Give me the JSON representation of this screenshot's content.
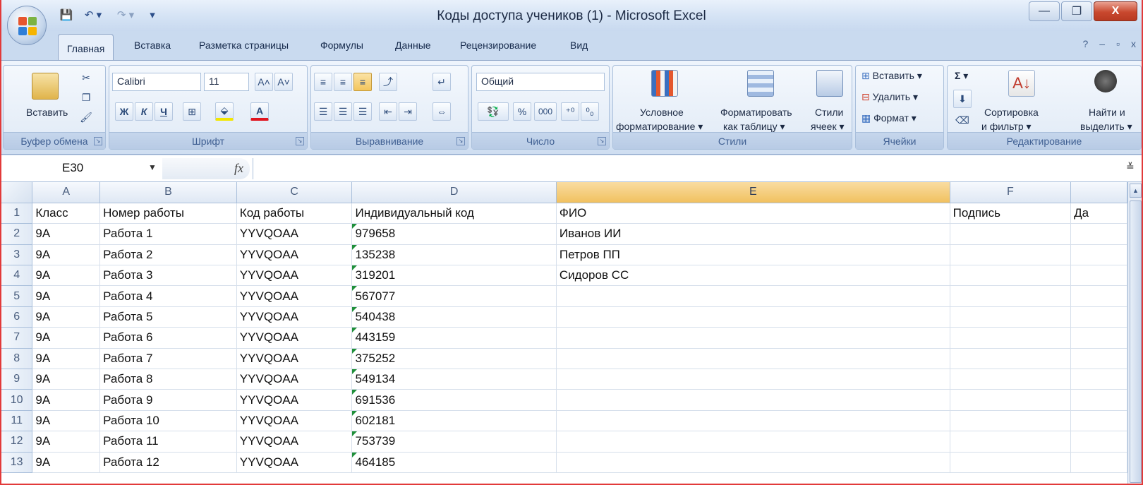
{
  "window": {
    "title": "Коды доступа учеников (1) - Microsoft Excel",
    "minimize": "—",
    "restore": "❐",
    "close": "X"
  },
  "qat": {
    "save": "💾",
    "undo": "↶ ▾",
    "redo": "↷ ▾",
    "customize": "▾"
  },
  "tabs": [
    "Главная",
    "Вставка",
    "Разметка страницы",
    "Формулы",
    "Данные",
    "Рецензирование",
    "Вид"
  ],
  "help": {
    "help": "?",
    "min": "–",
    "restore": "▫",
    "close": "x"
  },
  "ribbon": {
    "clipboard": {
      "label": "Буфер обмена",
      "paste": "Вставить"
    },
    "font": {
      "label": "Шрифт",
      "name": "Calibri",
      "size": "11",
      "bold": "Ж",
      "italic": "К",
      "underline": "Ч",
      "grow": "A˄",
      "shrink": "A˅"
    },
    "alignment": {
      "label": "Выравнивание"
    },
    "number": {
      "label": "Число",
      "format": "Общий",
      "percent": "%",
      "thousands": "000",
      "inc_decimal": "⁺⁰",
      "dec_decimal": "⁰₀"
    },
    "styles": {
      "label": "Стили",
      "conditional_1": "Условное",
      "conditional_2": "форматирование ▾",
      "table_1": "Форматировать",
      "table_2": "как таблицу ▾",
      "cell_1": "Стили",
      "cell_2": "ячеек ▾"
    },
    "cells": {
      "label": "Ячейки",
      "insert": "Вставить ▾",
      "delete": "Удалить ▾",
      "format": "Формат ▾"
    },
    "editing": {
      "label": "Редактирование",
      "sum": "Σ ▾",
      "sort_1": "Сортировка",
      "sort_2": "и фильтр ▾",
      "find_1": "Найти и",
      "find_2": "выделить ▾"
    }
  },
  "formula_bar": {
    "cell": "E30",
    "fx": "fx",
    "value": "",
    "expand": "≚"
  },
  "sheet": {
    "columns": [
      "A",
      "B",
      "C",
      "D",
      "E",
      "F",
      ""
    ],
    "selected_column": "E",
    "rows": [
      {
        "n": "1",
        "cells": [
          "Класс",
          "Номер работы",
          "Код работы",
          "Индивидуальный код",
          "ФИО",
          "Подпись",
          "Да"
        ]
      },
      {
        "n": "2",
        "cells": [
          "9А",
          "Работа 1",
          "YYVQOAA",
          "979658",
          "Иванов ИИ",
          "",
          ""
        ]
      },
      {
        "n": "3",
        "cells": [
          "9А",
          "Работа 2",
          "YYVQOAA",
          "135238",
          "Петров ПП",
          "",
          ""
        ]
      },
      {
        "n": "4",
        "cells": [
          "9А",
          "Работа 3",
          "YYVQOAA",
          "319201",
          "Сидоров СС",
          "",
          ""
        ]
      },
      {
        "n": "5",
        "cells": [
          "9А",
          "Работа 4",
          "YYVQOAA",
          "567077",
          "",
          "",
          ""
        ]
      },
      {
        "n": "6",
        "cells": [
          "9А",
          "Работа 5",
          "YYVQOAA",
          "540438",
          "",
          "",
          ""
        ]
      },
      {
        "n": "7",
        "cells": [
          "9А",
          "Работа 6",
          "YYVQOAA",
          "443159",
          "",
          "",
          ""
        ]
      },
      {
        "n": "8",
        "cells": [
          "9А",
          "Работа 7",
          "YYVQOAA",
          "375252",
          "",
          "",
          ""
        ]
      },
      {
        "n": "9",
        "cells": [
          "9А",
          "Работа 8",
          "YYVQOAA",
          "549134",
          "",
          "",
          ""
        ]
      },
      {
        "n": "10",
        "cells": [
          "9А",
          "Работа 9",
          "YYVQOAA",
          "691536",
          "",
          "",
          ""
        ]
      },
      {
        "n": "11",
        "cells": [
          "9А",
          "Работа 10",
          "YYVQOAA",
          "602181",
          "",
          "",
          ""
        ]
      },
      {
        "n": "12",
        "cells": [
          "9А",
          "Работа 11",
          "YYVQOAA",
          "753739",
          "",
          "",
          ""
        ]
      },
      {
        "n": "13",
        "cells": [
          "9А",
          "Работа 12",
          "YYVQOAA",
          "464185",
          "",
          "",
          ""
        ]
      }
    ]
  },
  "colors": {
    "selected_header": "#f1c15f",
    "ribbon": "#dde8f6",
    "text_number_marker": "#1f8f3a"
  }
}
